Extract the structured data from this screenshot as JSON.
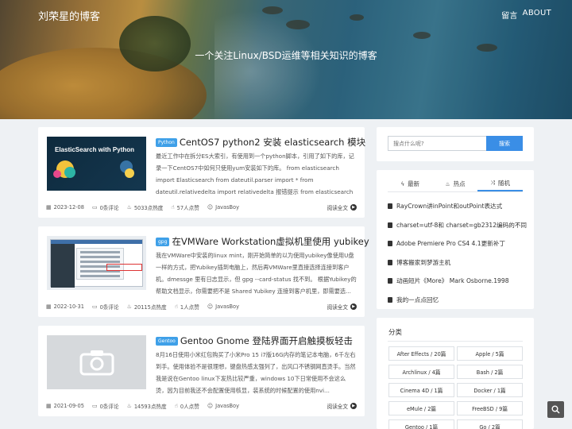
{
  "site": {
    "brand": "刘荣星的博客",
    "nav": [
      "留言",
      "ABOUT"
    ],
    "tagline": "一个关注Linux/BSD运维等相关知识的博客"
  },
  "posts": [
    {
      "tag": "Python",
      "title": "CentOS7 python2 安装 elasticsearch 模块",
      "thumb_text": "ElasticSearch with Python",
      "excerpt": "最近工作中在拆分ES大索引，有使用到一个python脚本，引用了如下的库，记录一下CentOS7中如何只使用yum安装如下的库。 from elasticsearch import Elasticsearch from dateutil.parser import * from dateutil.relativedelta import relativedelta 报错提示 from elasticsearch import Elasticsearch...",
      "date": "2023-12-08",
      "comments": "0条评论",
      "views": "5033点热度",
      "likes": "57人点赞",
      "author": "JavasBoy",
      "read_more": "阅读全文"
    },
    {
      "tag": "gpg",
      "title": "在VMWare Workstation虚拟机里使用 yubikey",
      "excerpt": "我在VMWare中安装的linux mint，刚开始简单的以为使用yubikey像使用U盘一样的方式，把Yubikey插到电脑上，然后再VMWare里直接选择连接到客户机。dmessge 里有日志显示，但 gpg --card-status 找不到。 根据Yubikey的帮助文档显示，你需要把不是 Shared Yubikey 连接到客户机里，即需要选...",
      "date": "2022-10-31",
      "comments": "0条评论",
      "views": "20115点热度",
      "likes": "1人点赞",
      "author": "JavasBoy",
      "read_more": "阅读全文"
    },
    {
      "tag": "Gentoo",
      "title": "Gentoo Gnome 登陆界面开启触摸板轻击",
      "excerpt": "8月16日使用小米红包购买了小米Pro 15 i7版16G内存的笔记本电脑，6千左右到手。使用体验不是很理想，键盘热感太强列了，出风口不锈钢网直烫手。当然我是说在Gentoo linux下发热比较严重，windows 10下日常使用不会这么烫，因为目前我还不会配置使用核显，装系统的时候配置的使用nvi...",
      "date": "2021-09-05",
      "comments": "0条评论",
      "views": "14593点热度",
      "likes": "0人点赞",
      "author": "JavasBoy",
      "read_more": "阅读全文"
    }
  ],
  "sidebar": {
    "search_placeholder": "搜点什么呢?",
    "search_button": "搜索",
    "tabs": [
      "最新",
      "热点",
      "随机"
    ],
    "active_tab": "随机",
    "random_posts": [
      "RayCrown讲inPoint和outPoint表达式",
      "charset=utf-8和 charset=gb2312编码的不同",
      "Adobe Premiere Pro CS4 4.1更新补丁",
      "博客搬家到梦游主机",
      "动画短片《More》 Mark Osborne.1998",
      "我的一点点回忆"
    ],
    "categories_title": "分类",
    "categories": [
      "After Effects / 20篇",
      "Apple / 5篇",
      "Archlinux / 4篇",
      "Bash / 2篇",
      "Cinema 4D / 1篇",
      "Docker / 1篇",
      "eMule / 2篇",
      "FreeBSD / 9篇",
      "Gentoo / 1篇",
      "Go / 2篇"
    ]
  },
  "icons": {
    "calendar": "calendar-icon",
    "comment": "comment-icon",
    "fire": "fire-icon",
    "like": "thumbs-up-icon",
    "user": "user-icon",
    "arrow": "arrow-right-icon",
    "book": "book-icon",
    "search": "search-icon"
  },
  "colors": {
    "accent": "#3a8ee6",
    "tag": "#3fa0e8",
    "background": "#eef1f4"
  }
}
